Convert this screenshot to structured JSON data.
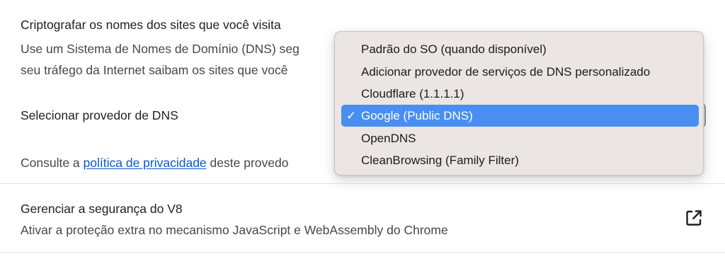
{
  "dns": {
    "title": "Criptografar os nomes dos sites que você visita",
    "description_line1": "Use um Sistema de Nomes de Domínio (DNS) seg",
    "description_line2": "seu tráfego da Internet saibam os sites que você",
    "provider_label": "Selecionar provedor de DNS",
    "privacy_prefix": "Consulte a ",
    "privacy_link": "política de privacidade",
    "privacy_suffix": " deste provedo"
  },
  "dropdown": {
    "selected_index": 3,
    "options": [
      "Padrão do SO (quando disponível)",
      "Adicionar provedor de serviços de DNS personalizado",
      "Cloudflare (1.1.1.1)",
      "Google (Public DNS)",
      "OpenDNS",
      "CleanBrowsing (Family Filter)"
    ],
    "checkmark": "✓"
  },
  "v8": {
    "title": "Gerenciar a segurança do V8",
    "subtitle": "Ativar a proteção extra no mecanismo JavaScript e WebAssembly do Chrome",
    "icon": "external-link-icon"
  },
  "colors": {
    "link": "#0b57d0",
    "selection": "#4a8ef0",
    "menu_bg": "#ebe6e3"
  }
}
